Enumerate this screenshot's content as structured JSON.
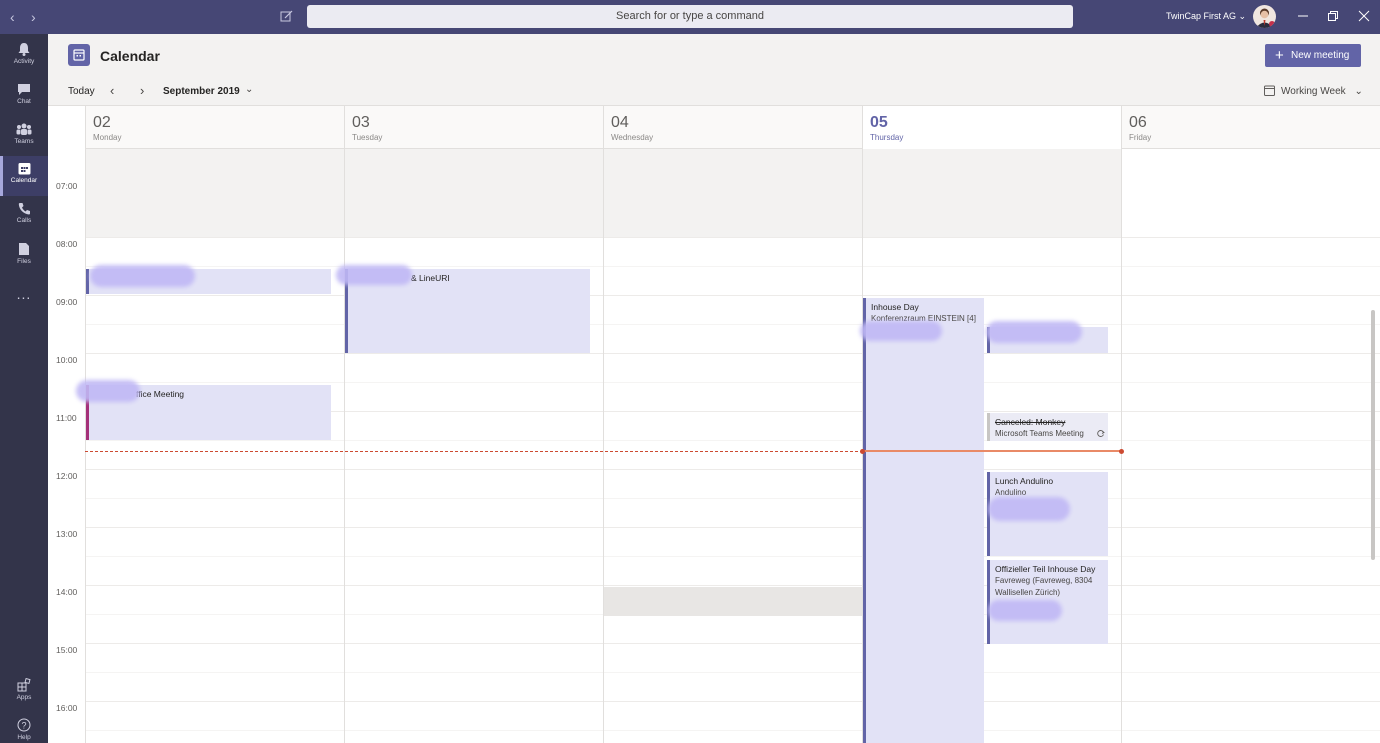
{
  "titlebar": {
    "back": "‹",
    "forward": "›",
    "search_placeholder": "Search for or type a command",
    "org": "TwinCap First AG ⌄"
  },
  "rail": {
    "items": [
      {
        "label": "Activity"
      },
      {
        "label": "Chat"
      },
      {
        "label": "Teams"
      },
      {
        "label": "Calendar"
      },
      {
        "label": "Calls"
      },
      {
        "label": "Files"
      }
    ],
    "more": "...",
    "apps": "Apps",
    "help": "Help"
  },
  "header": {
    "title": "Calendar",
    "new_meeting": "New meeting"
  },
  "toolbar": {
    "today": "Today",
    "prev": "‹",
    "next": "›",
    "month": "September 2019",
    "view": "Working Week",
    "chev": "⌄"
  },
  "days": [
    {
      "num": "02",
      "name": "Monday"
    },
    {
      "num": "03",
      "name": "Tuesday"
    },
    {
      "num": "04",
      "name": "Wednesday"
    },
    {
      "num": "05",
      "name": "Thursday"
    },
    {
      "num": "06",
      "name": "Friday"
    }
  ],
  "times": [
    "07:00",
    "08:00",
    "09:00",
    "10:00",
    "11:00",
    "12:00",
    "13:00",
    "14:00",
    "15:00",
    "16:00"
  ],
  "events": {
    "tue_lineuri": {
      "title": "& LineURI"
    },
    "mon_office": {
      "title": "ffice Meeting"
    },
    "thu_inhouse": {
      "title": "Inhouse Day",
      "sub": "Konferenzraum EINSTEIN [4]"
    },
    "thu_canceled": {
      "title": "Canceled: Monkey",
      "sub": "Microsoft Teams Meeting"
    },
    "thu_lunch": {
      "title": "Lunch Andulino",
      "sub": "Andulino"
    },
    "thu_official": {
      "title": "Offizieller Teil Inhouse Day",
      "sub1": "Favreweg (Favreweg, 8304",
      "sub2": "Wallisellen Zürich)"
    }
  },
  "colors": {
    "brand": "#6264a7",
    "titlebar": "#464775",
    "rail": "#33344a",
    "event_bg": "#e2e2f6",
    "now_line": "#cc4a31"
  }
}
